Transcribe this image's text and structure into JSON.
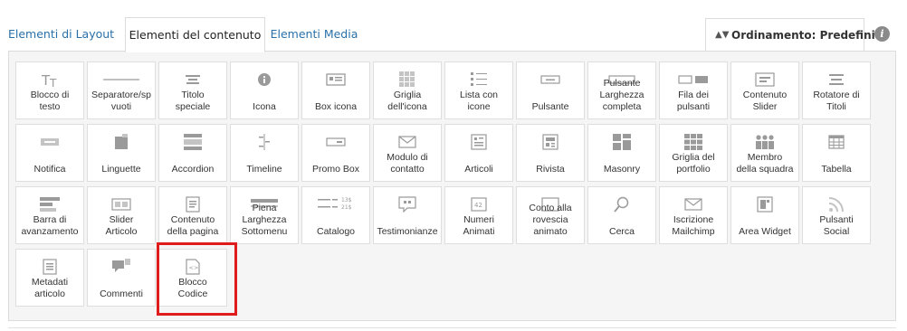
{
  "tabs": [
    {
      "label": "Elementi di Layout",
      "active": false
    },
    {
      "label": "Elementi del contenuto",
      "active": true
    },
    {
      "label": "Elementi Media",
      "active": false
    }
  ],
  "sort": {
    "label": "Ordinamento: Predefinito",
    "icon": "sort-arrows-icon"
  },
  "info": {
    "glyph": "i",
    "icon": "info-icon"
  },
  "accent": "#2a70a8",
  "highlight_color": "#e01b1b",
  "items": [
    {
      "label": "Blocco di\ntesto",
      "icon": "text-block-icon"
    },
    {
      "label": "Separatore/sp\nvuoti",
      "icon": "separator-icon"
    },
    {
      "label": "Titolo\nspeciale",
      "icon": "title-icon"
    },
    {
      "label": "Icona",
      "icon": "icon-icon"
    },
    {
      "label": "Box icona",
      "icon": "icon-box-icon"
    },
    {
      "label": "Griglia\ndell'icona",
      "icon": "icon-grid-icon"
    },
    {
      "label": "Lista con\nicone",
      "icon": "icon-list-icon"
    },
    {
      "label": "Pulsante",
      "icon": "button-icon"
    },
    {
      "label": "Pulsante\nLarghezza\ncompleta",
      "icon": "fullwidth-button-icon"
    },
    {
      "label": "Fila dei\npulsanti",
      "icon": "button-row-icon"
    },
    {
      "label": "Contenuto\nSlider",
      "icon": "content-slider-icon"
    },
    {
      "label": "Rotatore di\nTitoli",
      "icon": "title-rotator-icon"
    },
    {
      "label": "Notifica",
      "icon": "notification-icon"
    },
    {
      "label": "Linguette",
      "icon": "tabs-icon"
    },
    {
      "label": "Accordion",
      "icon": "accordion-icon"
    },
    {
      "label": "Timeline",
      "icon": "timeline-icon"
    },
    {
      "label": "Promo Box",
      "icon": "promo-box-icon"
    },
    {
      "label": "Modulo di\ncontatto",
      "icon": "envelope-icon"
    },
    {
      "label": "Articoli",
      "icon": "articles-icon"
    },
    {
      "label": "Rivista",
      "icon": "magazine-icon"
    },
    {
      "label": "Masonry",
      "icon": "masonry-icon"
    },
    {
      "label": "Griglia del\nportfolio",
      "icon": "portfolio-grid-icon"
    },
    {
      "label": "Membro\ndella squadra",
      "icon": "team-member-icon"
    },
    {
      "label": "Tabella",
      "icon": "table-icon"
    },
    {
      "label": "Barra di\navanzamento",
      "icon": "progress-bar-icon"
    },
    {
      "label": "Slider\nArticolo",
      "icon": "post-slider-icon"
    },
    {
      "label": "Contenuto\ndella pagina",
      "icon": "page-content-icon"
    },
    {
      "label": "Piena\nLarghezza\nSottomenu",
      "icon": "fullwidth-submenu-icon"
    },
    {
      "label": "Catalogo",
      "icon": "catalog-icon"
    },
    {
      "label": "Testimonianze",
      "icon": "testimonials-icon"
    },
    {
      "label": "Numeri\nAnimati",
      "icon": "animated-numbers-icon"
    },
    {
      "label": "Conto alla\nrovescia\nanimato",
      "icon": "countdown-icon"
    },
    {
      "label": "Cerca",
      "icon": "search-icon"
    },
    {
      "label": "Iscrizione\nMailchimp",
      "icon": "mailchimp-icon"
    },
    {
      "label": "Area Widget",
      "icon": "widget-area-icon"
    },
    {
      "label": "Pulsanti\nSocial",
      "icon": "social-buttons-icon"
    },
    {
      "label": "Metadati\narticolo",
      "icon": "post-meta-icon"
    },
    {
      "label": "Commenti",
      "icon": "comments-icon"
    },
    {
      "label": "Blocco\nCodice",
      "icon": "code-block-icon",
      "highlighted": true
    }
  ],
  "catalog_icon_text": [
    "13$",
    "21$"
  ],
  "numbers_icon_text": "42"
}
